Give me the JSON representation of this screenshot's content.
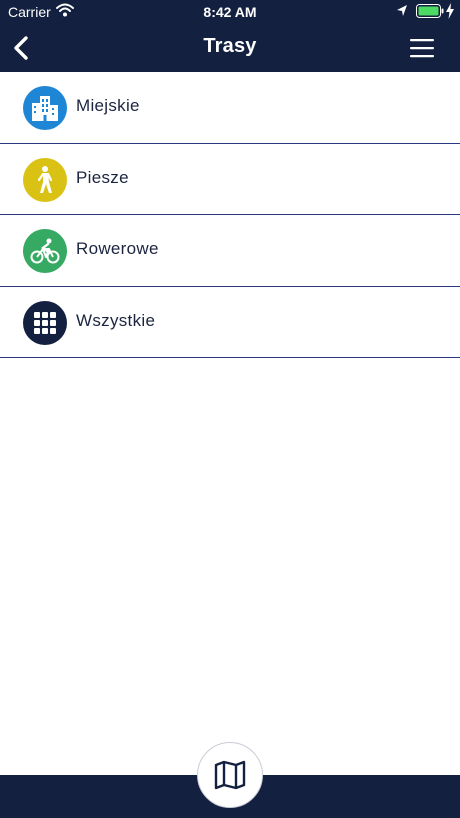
{
  "status": {
    "carrier": "Carrier",
    "time": "8:42 AM"
  },
  "nav": {
    "title": "Trasy"
  },
  "routes": [
    {
      "label": "Miejskie",
      "icon": "city-buildings-icon",
      "color": "#1f86d6"
    },
    {
      "label": "Piesze",
      "icon": "pedestrian-icon",
      "color": "#d9c214"
    },
    {
      "label": "Rowerowe",
      "icon": "cyclist-icon",
      "color": "#36a962"
    },
    {
      "label": "Wszystkie",
      "icon": "grid-icon",
      "color": "#13203f"
    }
  ],
  "colors": {
    "header_bg": "#13203f",
    "divider": "#2b3a80",
    "battery": "#4cd964"
  },
  "bottom": {
    "map_button_icon": "map-icon"
  }
}
